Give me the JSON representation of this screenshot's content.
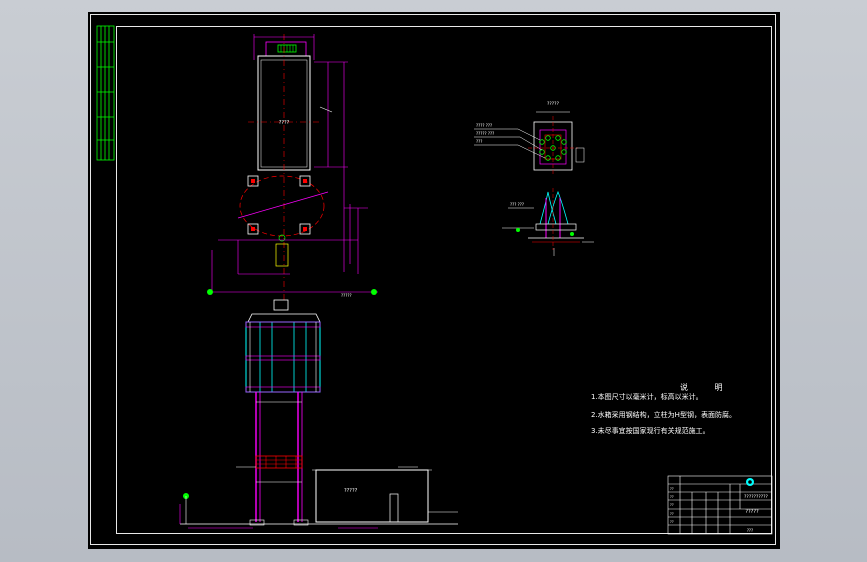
{
  "drawing": {
    "background_color": "#000000",
    "frame_color": "#e8e8e8",
    "colors": {
      "magenta": "#ff00ff",
      "cyan": "#00ffff",
      "green": "#00ff00",
      "red": "#ff0000",
      "white": "#ffffff",
      "yellow": "#ffff00"
    }
  },
  "labels": {
    "plan_center": "????",
    "tank_room": "?????",
    "elevation_top": "?????",
    "detail_title": "?????",
    "detail_leader_1": "???? ???",
    "detail_leader_2": "????? ???",
    "detail_leader_3": "???",
    "detail2_leader": "??? ???",
    "pump_house": "?????"
  },
  "notes": {
    "title": "说 明",
    "lines": [
      "1.本图尺寸以毫米计，标高以米计。",
      "2.水箱采用钢结构，立柱为H型钢，表面防腐。",
      "3.未尽事宜按国家现行有关规范施工。"
    ]
  },
  "title_block": {
    "drawing_name": "?????",
    "drawing_no": "??????????",
    "logo": "compass-logo",
    "small_labels": [
      "??",
      "??",
      "??",
      "??",
      "??"
    ],
    "footer_label": "???"
  }
}
